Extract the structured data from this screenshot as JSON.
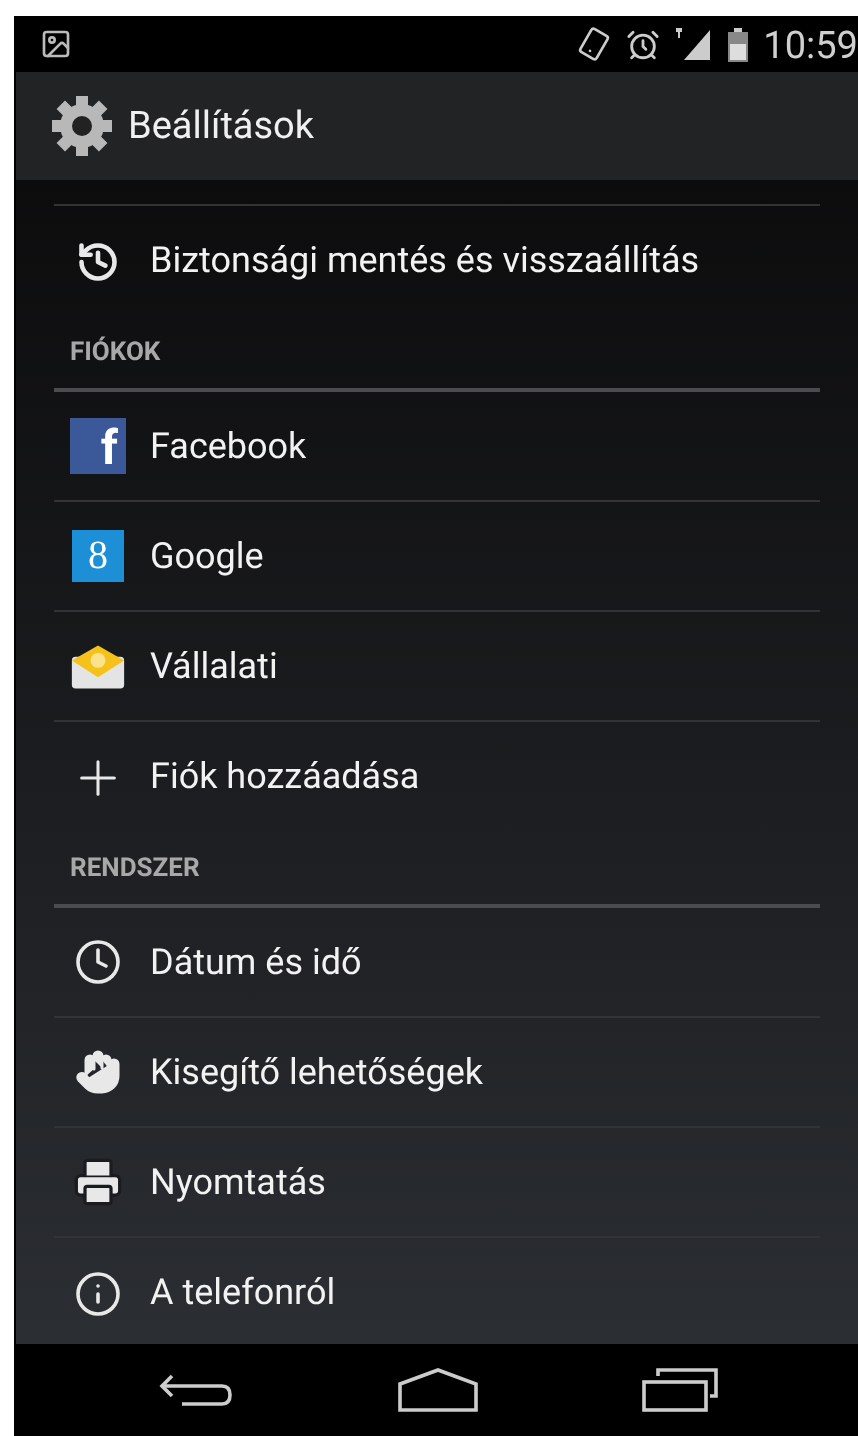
{
  "status_bar": {
    "time": "10:59"
  },
  "action_bar": {
    "title": "Beállítások"
  },
  "rows": [
    {
      "kind": "item",
      "label": "Biztonsági mentés és visszaállítás"
    },
    {
      "kind": "header",
      "label": "FIÓKOK"
    },
    {
      "kind": "item",
      "label": "Facebook",
      "logo_text": "f"
    },
    {
      "kind": "item",
      "label": "Google",
      "logo_text": "8"
    },
    {
      "kind": "item",
      "label": "Vállalati"
    },
    {
      "kind": "item",
      "label": "Fiók hozzáadása"
    },
    {
      "kind": "header",
      "label": "RENDSZER"
    },
    {
      "kind": "item",
      "label": "Dátum és idő"
    },
    {
      "kind": "item",
      "label": "Kisegítő lehetőségek"
    },
    {
      "kind": "item",
      "label": "Nyomtatás"
    },
    {
      "kind": "item",
      "label": "A telefonról"
    }
  ]
}
